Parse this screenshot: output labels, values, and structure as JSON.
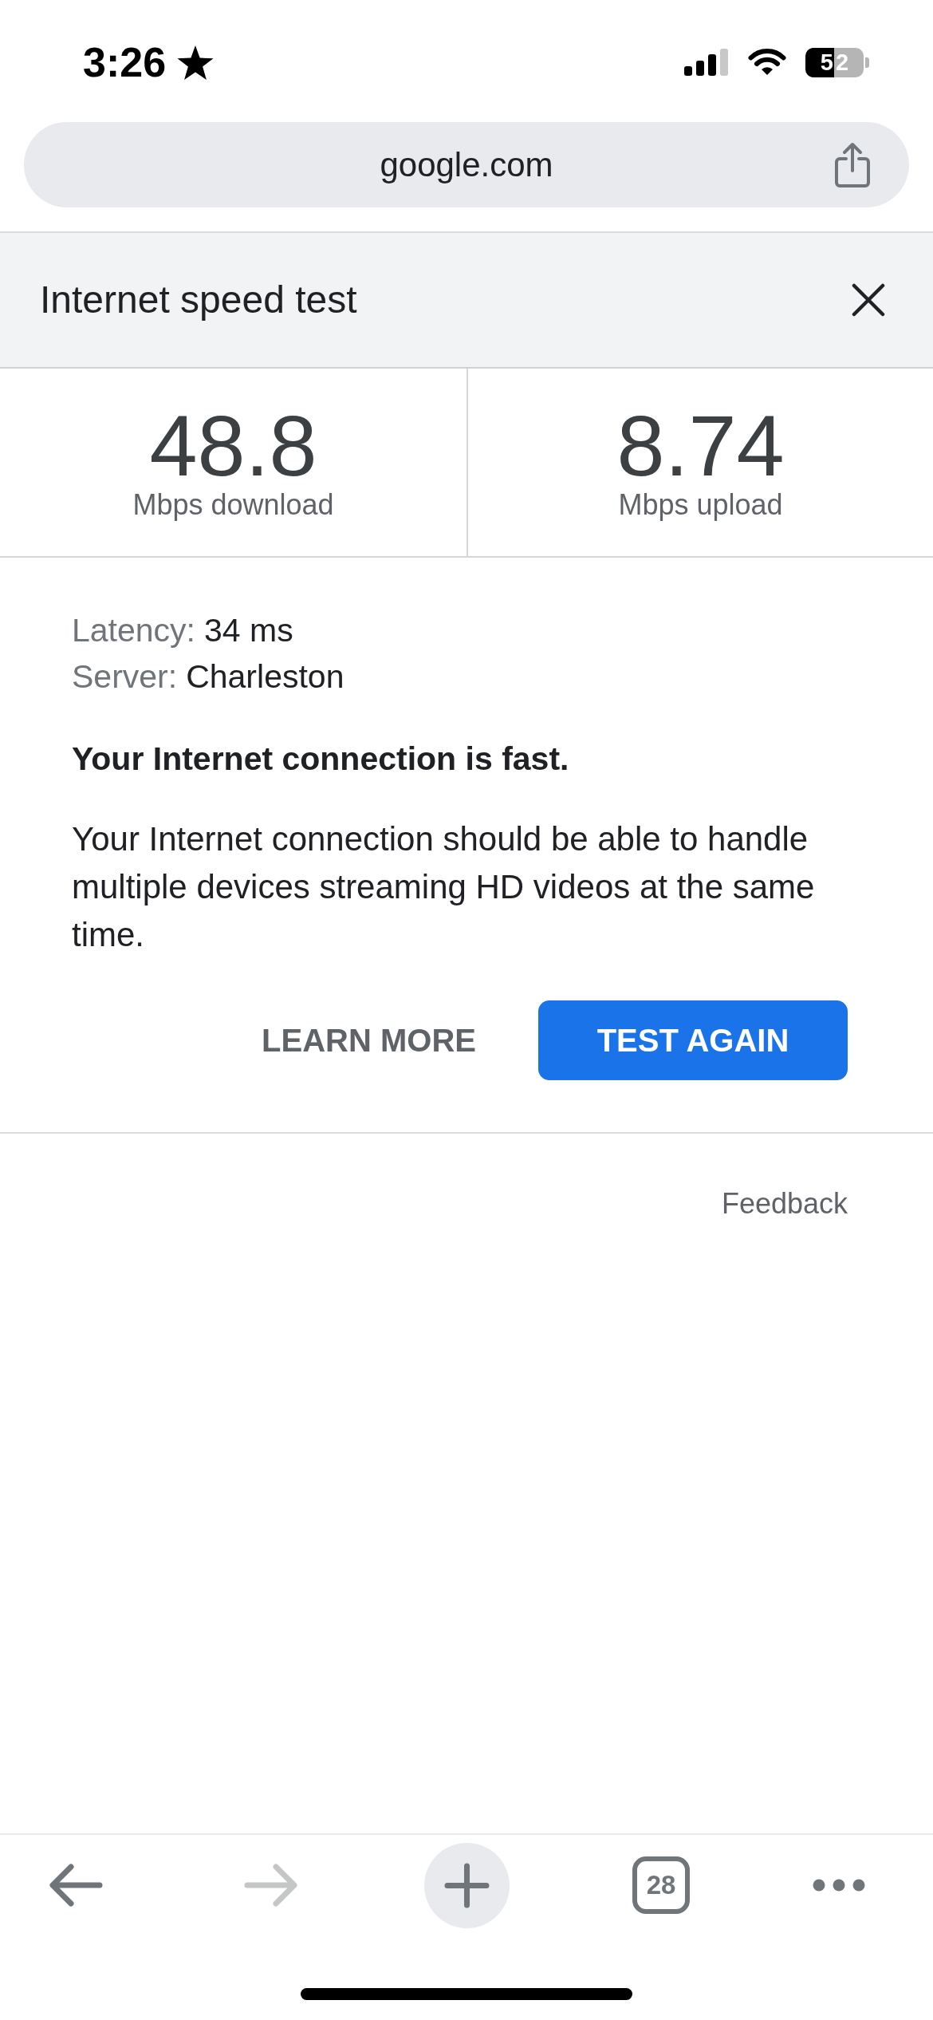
{
  "status_bar": {
    "time": "3:26",
    "battery": "52"
  },
  "address_bar": {
    "url": "google.com"
  },
  "panel": {
    "title": "Internet speed test"
  },
  "speeds": [
    {
      "value": "48.8",
      "unit": "Mbps download"
    },
    {
      "value": "8.74",
      "unit": "Mbps upload"
    }
  ],
  "details": [
    {
      "label": "Latency:",
      "value": "34 ms"
    },
    {
      "label": "Server:",
      "value": "Charleston"
    }
  ],
  "verdict": "Your Internet connection is fast.",
  "description": "Your Internet connection should be able to handle multiple devices streaming HD videos at the same time.",
  "actions": [
    {
      "label": "LEARN MORE",
      "kind": "text"
    },
    {
      "label": "TEST AGAIN",
      "kind": "filled"
    }
  ],
  "feedback": "Feedback",
  "toolbar": {
    "buttons": [
      {
        "kind": "back",
        "disabled": false
      },
      {
        "kind": "forward",
        "disabled": true
      },
      {
        "kind": "new-tab",
        "disabled": false
      },
      {
        "kind": "tabs",
        "count": "28",
        "disabled": false
      },
      {
        "kind": "menu",
        "disabled": false
      }
    ]
  }
}
